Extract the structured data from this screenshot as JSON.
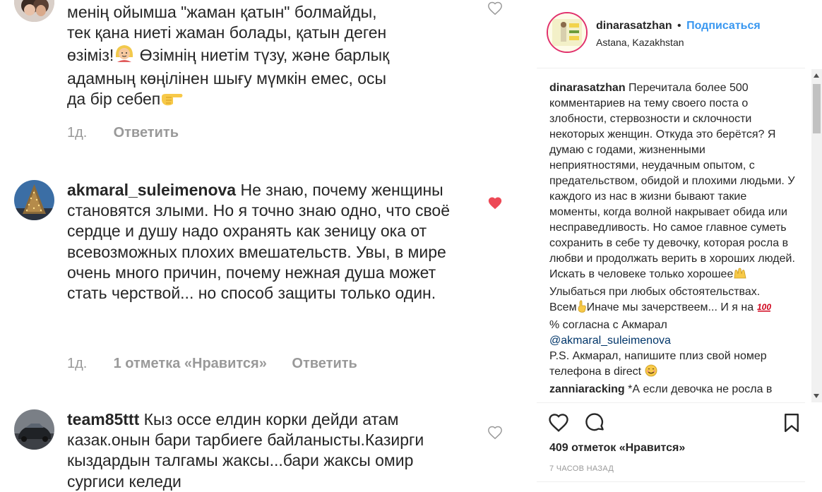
{
  "comments": [
    {
      "text_lines": [
        "менің ойымша \"жаман қатын\" болмайды,",
        "тек қана ниеті жаман болады, қатын деген",
        "өзіміз!",
        " Өзімнің ниетім түзу, және барлық",
        "адамның көңілінен шығу мүмкін емес, осы",
        "да бір себеп"
      ],
      "time": "1д.",
      "reply": "Ответить",
      "liked": false
    },
    {
      "user": "akmaral_suleimenova",
      "text": "Не знаю, почему женщины становятся злыми. Но я точно знаю одно, что своё сердце и душу надо охранять как зеницу ока от всевозможных плохих вмешательств. Увы, в мире очень много причин, почему нежная душа может стать черствой... но способ защиты только один.",
      "time": "1д.",
      "likes": "1 отметка «Нравится»",
      "reply": "Ответить",
      "liked": true
    },
    {
      "user": "team85ttt",
      "text": "Кыз оссе елдин корки дейди атам казак.онын бари тарбиеге байланысты.Казирги кыздардын талгамы жаксы...бари жаксы омир сургиси келеди",
      "liked": false
    }
  ],
  "post": {
    "username": "dinarasatzhan",
    "dot": "•",
    "follow": "Подписаться",
    "location": "Astana, Kazakhstan",
    "caption_user": "dinarasatzhan",
    "caption_part1": "Перечитала более 500 комментариев на тему своего поста о злобности, стервозности и склочности некоторых женщин. Откуда это берётся? Я думаю с годами, жизненными неприятностями, неудачным опытом, с предательством, обидой и плохими людьми. У каждого из нас в жизни бывают такие моменты, когда волной накрывает обида или несправедливость. Но самое главное суметь сохранить в себе ту девочку, которая росла в любви и продолжать верить в хороших людей.",
    "caption_part2": "Искать в человеке только хорошее",
    "caption_part3": "Улыбаться при любых обстоятельствах.",
    "caption_part4": "Всем",
    "caption_part5": "Иначе мы зачерствеем... И я на",
    "caption_part6": "% согласна с Акмарал",
    "caption_mention": "@akmaral_suleimenova",
    "caption_part7": "P.S. Акмарал, напишите плиз свой номер телефона в direct",
    "next_comment_user": "zanniaracking",
    "next_comment_text": "*А если девочка не росла в",
    "likes": "409 отметок «Нравится»",
    "time": "7 ЧАСОВ НАЗАД"
  },
  "icons": {
    "comment_like": "heart-outline-icon",
    "comment_liked": "heart-filled-icon",
    "post_like": "heart-outline-icon",
    "post_comment": "speech-bubble-icon",
    "post_save": "bookmark-icon"
  },
  "colors": {
    "liked_heart": "#ed4956",
    "follow_link": "#3897f0",
    "meta_text": "#999999"
  }
}
